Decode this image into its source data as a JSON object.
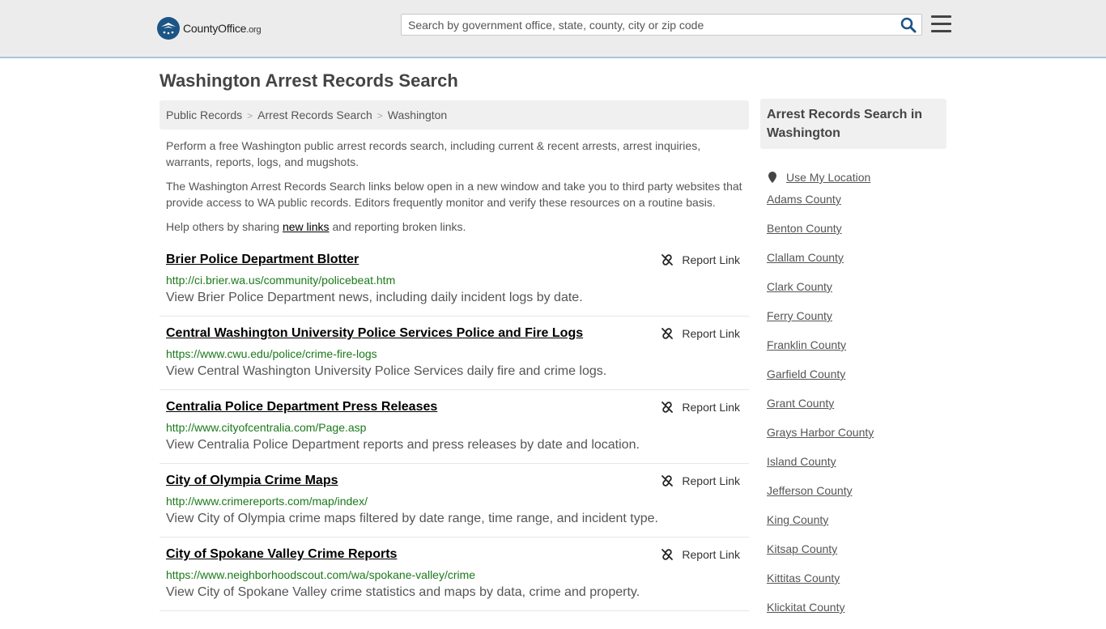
{
  "header": {
    "logo_brand": "CountyOffice",
    "logo_tld": ".org",
    "search_placeholder": "Search by government office, state, county, city or zip code",
    "icons": {
      "search": "search-icon",
      "menu": "hamburger-menu-icon",
      "logo": "county-office-logo-icon"
    }
  },
  "page": {
    "title": "Washington Arrest Records Search",
    "breadcrumb": [
      "Public Records",
      "Arrest Records Search",
      "Washington"
    ],
    "intro_1": "Perform a free Washington public arrest records search, including current & recent arrests, arrest inquiries, warrants, reports, logs, and mugshots.",
    "intro_2": "The Washington Arrest Records Search links below open in a new window and take you to third party websites that provide access to WA public records. Editors frequently monitor and verify these resources on a routine basis.",
    "intro_3_before": "Help others by sharing ",
    "intro_3_link": "new links",
    "intro_3_after": " and reporting broken links."
  },
  "results": [
    {
      "title": "Brier Police Department Blotter",
      "url": "http://ci.brier.wa.us/community/policebeat.htm",
      "desc": "View Brier Police Department news, including daily incident logs by date.",
      "report": "Report Link"
    },
    {
      "title": "Central Washington University Police Services Police and Fire Logs",
      "url": "https://www.cwu.edu/police/crime-fire-logs",
      "desc": "View Central Washington University Police Services daily fire and crime logs.",
      "report": "Report Link"
    },
    {
      "title": "Centralia Police Department Press Releases",
      "url": "http://www.cityofcentralia.com/Page.asp",
      "desc": "View Centralia Police Department reports and press releases by date and location.",
      "report": "Report Link"
    },
    {
      "title": "City of Olympia Crime Maps",
      "url": "http://www.crimereports.com/map/index/",
      "desc": "View City of Olympia crime maps filtered by date range, time range, and incident type.",
      "report": "Report Link"
    },
    {
      "title": "City of Spokane Valley Crime Reports",
      "url": "https://www.neighborhoodscout.com/wa/spokane-valley/crime",
      "desc": "View City of Spokane Valley crime statistics and maps by data, crime and property.",
      "report": "Report Link"
    }
  ],
  "sidebar": {
    "heading": "Arrest Records Search in Washington",
    "use_location": "Use My Location",
    "counties": [
      "Adams County",
      "Benton County",
      "Clallam County",
      "Clark County",
      "Ferry County",
      "Franklin County",
      "Garfield County",
      "Grant County",
      "Grays Harbor County",
      "Island County",
      "Jefferson County",
      "King County",
      "Kitsap County",
      "Kittitas County",
      "Klickitat County"
    ]
  }
}
